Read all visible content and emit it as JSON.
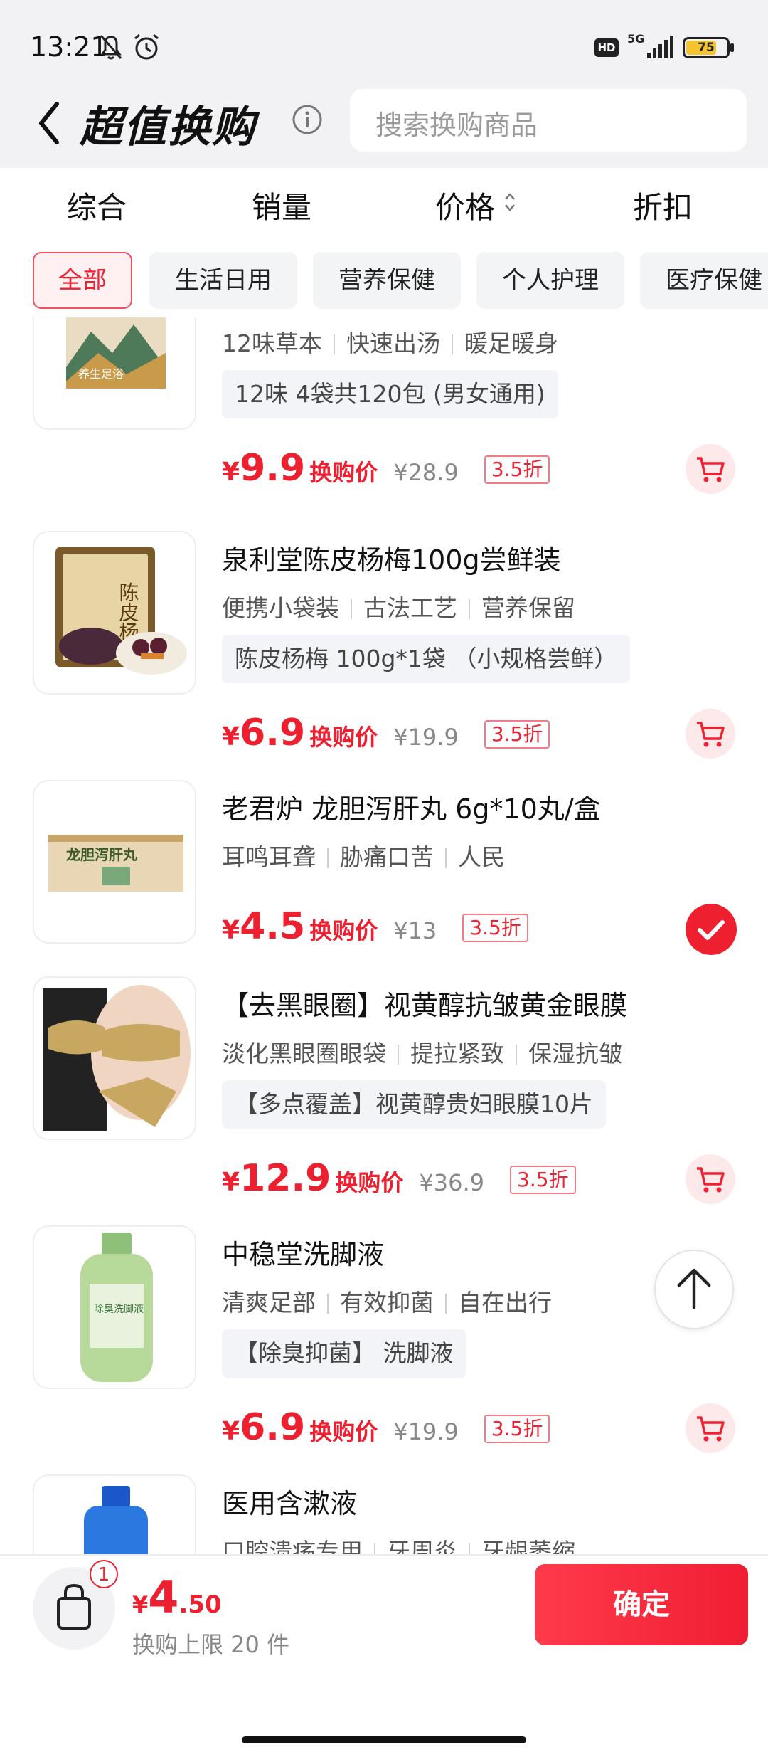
{
  "status_bar": {
    "time": "13:21",
    "network": "5G",
    "hd": "HD",
    "battery": "75",
    "battery_level": 0.75
  },
  "header": {
    "title": "超值换购",
    "search_placeholder": "搜索换购商品"
  },
  "sort_tabs": [
    "综合",
    "销量",
    "价格",
    "折扣"
  ],
  "categories": [
    {
      "label": "全部",
      "active": true
    },
    {
      "label": "生活日用",
      "active": false
    },
    {
      "label": "营养保健",
      "active": false
    },
    {
      "label": "个人护理",
      "active": false
    },
    {
      "label": "医疗保健",
      "active": false
    }
  ],
  "price_label": "换购价",
  "currency": "¥",
  "products": [
    {
      "name": "",
      "tags": [
        "12味草本",
        "快速出汤",
        "暖足暖身"
      ],
      "spec": "12味 4袋共120包 (男女通用)",
      "price": "9.9",
      "original": "¥28.9",
      "discount": "3.5折",
      "selected": false,
      "thumb_text": "养生足浴"
    },
    {
      "name": "泉利堂陈皮杨梅100g尝鲜装",
      "tags": [
        "便携小袋装",
        "古法工艺",
        "营养保留"
      ],
      "spec": "陈皮杨梅 100g*1袋 （小规格尝鲜）",
      "price": "6.9",
      "original": "¥19.9",
      "discount": "3.5折",
      "selected": false,
      "thumb_text": "陈皮杨梅"
    },
    {
      "name": "老君炉 龙胆泻肝丸 6g*10丸/盒",
      "tags": [
        "耳鸣耳聋",
        "胁痛口苦",
        "人民"
      ],
      "spec": "",
      "price": "4.5",
      "original": "¥13",
      "discount": "3.5折",
      "selected": true,
      "thumb_text": "龙胆泻肝丸"
    },
    {
      "name": "【去黑眼圈】视黄醇抗皱黄金眼膜",
      "tags": [
        "淡化黑眼圈眼袋",
        "提拉紧致",
        "保湿抗皱"
      ],
      "spec": "【多点覆盖】视黄醇贵妇眼膜10片",
      "price": "12.9",
      "original": "¥36.9",
      "discount": "3.5折",
      "selected": false,
      "thumb_text": ""
    },
    {
      "name": "中稳堂洗脚液",
      "tags": [
        "清爽足部",
        "有效抑菌",
        "自在出行"
      ],
      "spec": "【除臭抑菌】 洗脚液",
      "price": "6.9",
      "original": "¥19.9",
      "discount": "3.5折",
      "selected": false,
      "thumb_text": "除臭洗脚液"
    },
    {
      "name": "医用含漱液",
      "tags": [
        "口腔溃疡专用",
        "牙周炎",
        "牙龈萎缩"
      ],
      "spec": "",
      "price": "",
      "original": "",
      "discount": "",
      "selected": false,
      "thumb_text": ""
    }
  ],
  "footer": {
    "count": "1",
    "total_yen": "¥",
    "total_int": "4",
    "total_dec": ".50",
    "limit_text": "换购上限 20 件",
    "confirm_label": "确定"
  },
  "colors": {
    "accent": "#ee1f2f",
    "page_bg": "#f2f2f4"
  }
}
